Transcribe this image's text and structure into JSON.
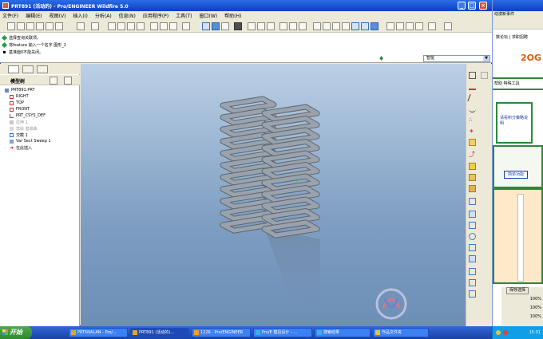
{
  "window": {
    "title": "PRT891 (活动的) - Pro/ENGINEER Wildfire 5.0",
    "controls": [
      "_",
      "□",
      "×"
    ]
  },
  "menu": [
    "文件(F)",
    "编辑(E)",
    "视图(V)",
    "插入(I)",
    "分析(A)",
    "信息(N)",
    "应用程序(P)",
    "工具(T)",
    "窗口(W)",
    "帮助(H)"
  ],
  "messages": [
    "选择查询关联项。",
    "将feature 输入一个名字    图形_1",
    "基准面0不能关闭。"
  ],
  "filter": {
    "value": "智能"
  },
  "model_tree": {
    "header": "模型树",
    "items": [
      {
        "label": "PRT891.PRT",
        "icon": "part-icon",
        "faded": false
      },
      {
        "label": "RIGHT",
        "icon": "datum-plane-icon",
        "faded": false
      },
      {
        "label": "TOP",
        "icon": "datum-plane-icon",
        "faded": false
      },
      {
        "label": "FRONT",
        "icon": "datum-plane-icon",
        "faded": false
      },
      {
        "label": "PRT_CSYS_DEF",
        "icon": "csys-icon",
        "faded": false
      },
      {
        "label": "拉伸 1",
        "icon": "extrude-icon",
        "faded": true
      },
      {
        "label": "草绘 基准曲",
        "icon": "sketch-icon",
        "faded": true
      },
      {
        "label": "交截 1",
        "icon": "intersect-icon",
        "faded": false
      },
      {
        "label": "Var Sect Sweep 1",
        "icon": "sweep-icon",
        "faded": false
      },
      {
        "label": "在此插入",
        "icon": "insert-here-icon",
        "faded": false
      }
    ]
  },
  "browser": {
    "bar1": "动漫新事件",
    "link1": "数论坛 | 求职招聘",
    "logo": "2OG",
    "nav": "帮助  特殊工具",
    "box1_text": "请看积分策略说明",
    "button": "简单功能",
    "save": "保存选择",
    "zoom_values": [
      "100%",
      "100%",
      "100%"
    ]
  },
  "taskbar": {
    "start": "开始",
    "tasks": [
      "PRTNVALAN - Pro/...",
      "PRT891 (活动的)...",
      "1226 - Pro/ENGINEER",
      "Pro/E 模具设计 - ...",
      "搜索结果",
      "作品文件夹"
    ],
    "clock": "15:31"
  },
  "colors": {
    "viewport_top": "#bcd0e6",
    "viewport_bottom": "#6d8fb6",
    "model": "#9aa3ad",
    "taskbar": "#245edb",
    "accent_green": "#2a8a3a"
  }
}
